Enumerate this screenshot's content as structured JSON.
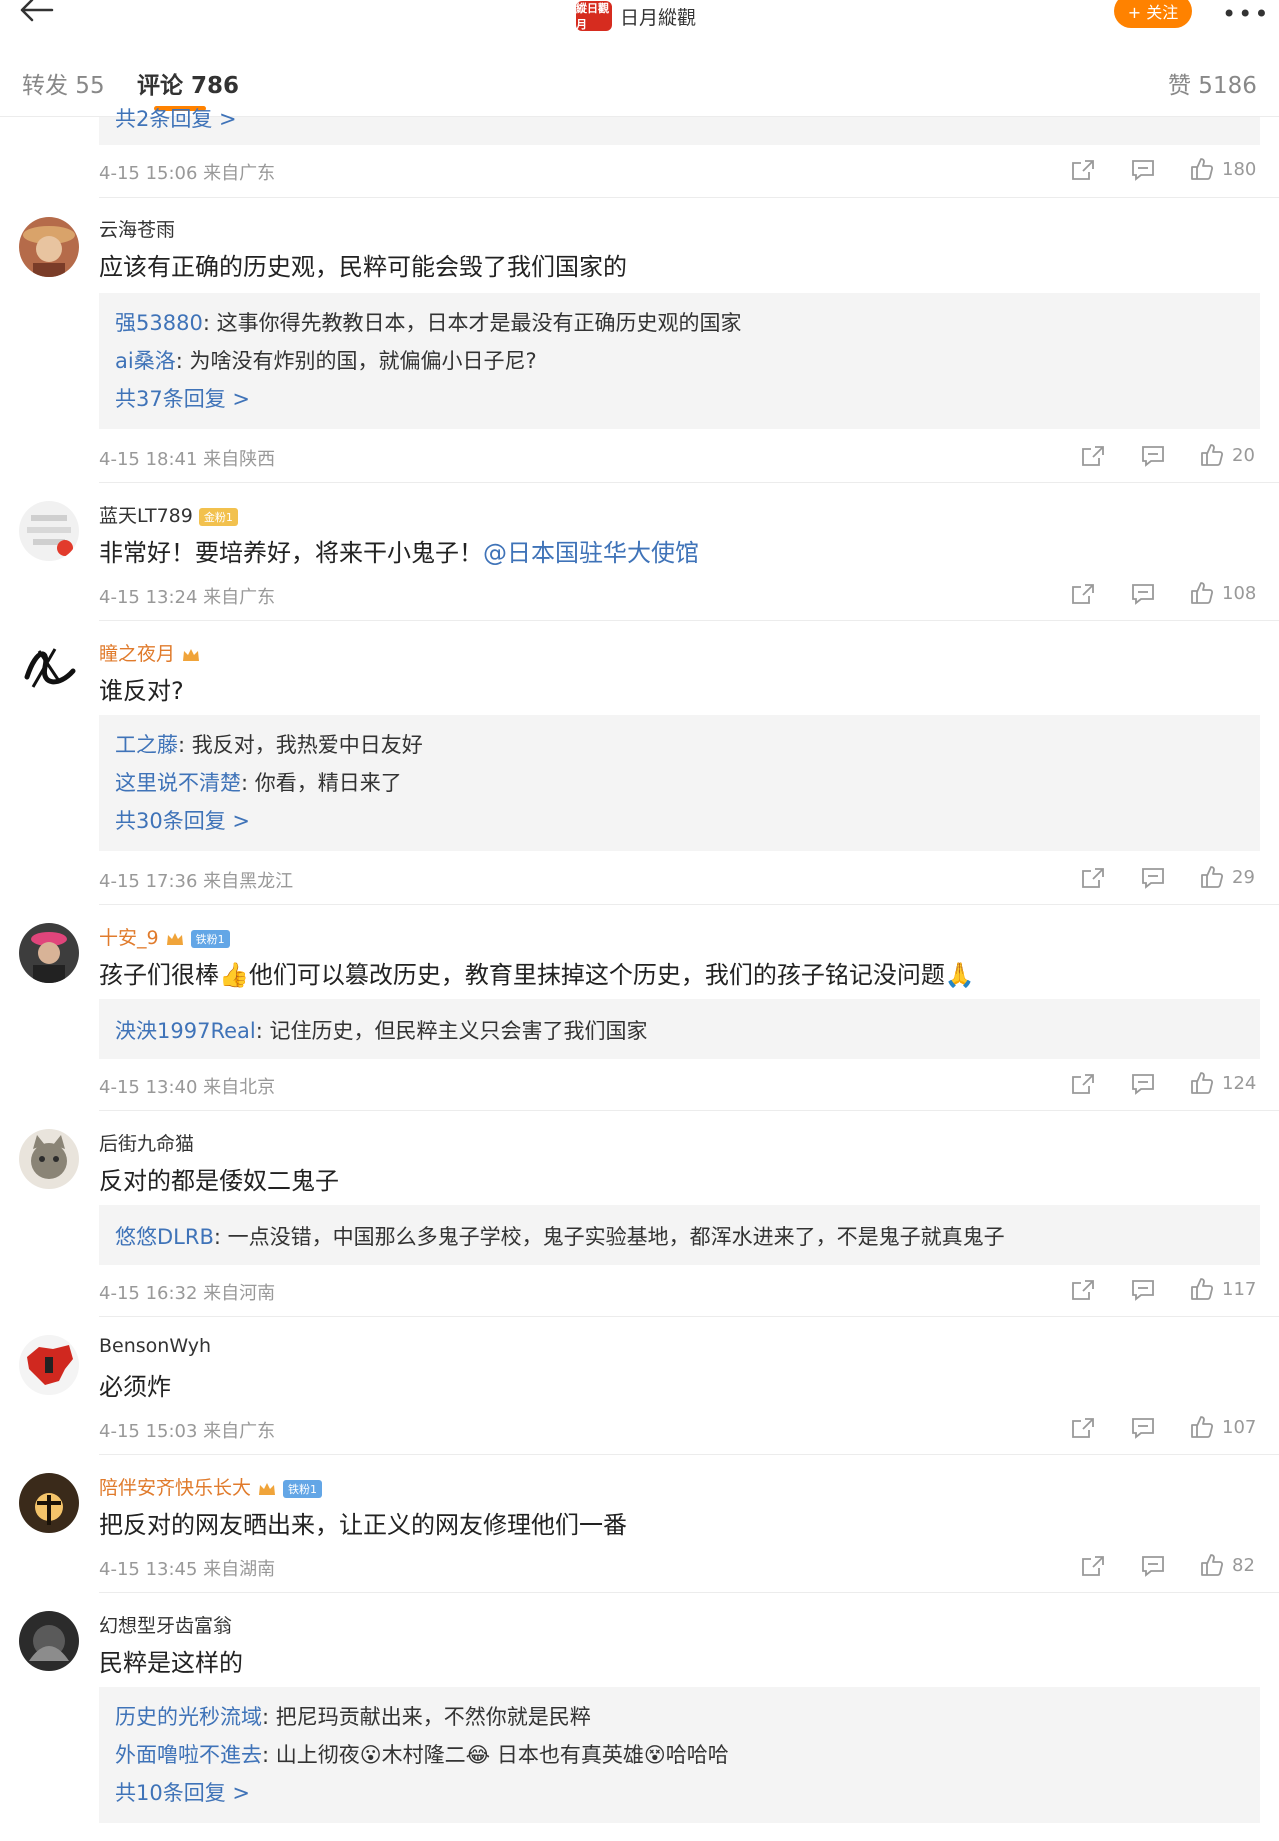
{
  "header": {
    "brand_logo_text": "縱日觀月",
    "brand_name": "日月縱觀",
    "follow_label": "+ 关注",
    "more_label": "•••"
  },
  "tabs": {
    "repost": "转发 55",
    "comments": "评论 786",
    "likes": "赞 5186"
  },
  "comments": [
    {
      "partial_more": "共2条回复 >",
      "meta": "4-15 15:06 来自广东",
      "likes": "180"
    },
    {
      "user": "云海苍雨",
      "text": "应该有正确的历史观，民粹可能会毁了我们国家的",
      "replies": [
        {
          "name": "强53880",
          "text": ": 这事你得先教教日本，日本才是最没有正确历史观的国家"
        },
        {
          "name": "ai桑洛",
          "text": ": 为啥没有炸别的国，就偏偏小日子尼?"
        }
      ],
      "more": "共37条回复 >",
      "meta": "4-15 18:41 来自陕西",
      "likes": "20"
    },
    {
      "user": "蓝天LT789",
      "badge": "金粉1",
      "text": "非常好！要培养好，将来干小鬼子！",
      "mention": "@日本国驻华大使馆",
      "meta": "4-15 13:24 来自广东",
      "likes": "108"
    },
    {
      "user": "瞳之夜月",
      "text": "谁反对?",
      "replies": [
        {
          "name": "工之藤",
          "text": ": 我反对，我热爱中日友好"
        },
        {
          "name": "这里说不清楚",
          "text": ": 你看，精日来了"
        }
      ],
      "more": "共30条回复 >",
      "meta": "4-15 17:36 来自黑龙江",
      "likes": "29"
    },
    {
      "user": "十安_9",
      "badge": "铁粉1",
      "text": "孩子们很棒👍他们可以篡改历史，教育里抹掉这个历史，我们的孩子铭记没问题🙏",
      "replies": [
        {
          "name": "泱泱1997Real",
          "text": ": 记住历史，但民粹主义只会害了我们国家"
        }
      ],
      "meta": "4-15 13:40 来自北京",
      "likes": "124"
    },
    {
      "user": "后街九命猫",
      "text": "反对的都是倭奴二鬼子",
      "replies": [
        {
          "name": "悠悠DLRB",
          "text": ": 一点没错，中国那么多鬼子学校，鬼子实验基地，都浑水进来了，不是鬼子就真鬼子"
        }
      ],
      "meta": "4-15 16:32 来自河南",
      "likes": "117"
    },
    {
      "user": "BensonWyh",
      "text": "必须炸",
      "meta": "4-15 15:03 来自广东",
      "likes": "107"
    },
    {
      "user": "陪伴安齐快乐长大",
      "badge": "铁粉1",
      "text": "把反对的网友晒出来，让正义的网友修理他们一番",
      "meta": "4-15 13:45 来自湖南",
      "likes": "82"
    },
    {
      "user": "幻想型牙齿富翁",
      "text": "民粹是这样的",
      "replies": [
        {
          "name": "历史的光秒流域",
          "text": ": 把尼玛贡献出来，不然你就是民粹"
        },
        {
          "name": "外面噜啦不進去",
          "text": ": 山上彻夜😮木村隆二😂 日本也有真英雄😵哈哈哈"
        }
      ],
      "more": "共10条回复 >"
    }
  ],
  "colors": {
    "accent_orange": "#ff8200",
    "link_blue": "#3f73b8",
    "vip_orange": "#e07b2c"
  }
}
